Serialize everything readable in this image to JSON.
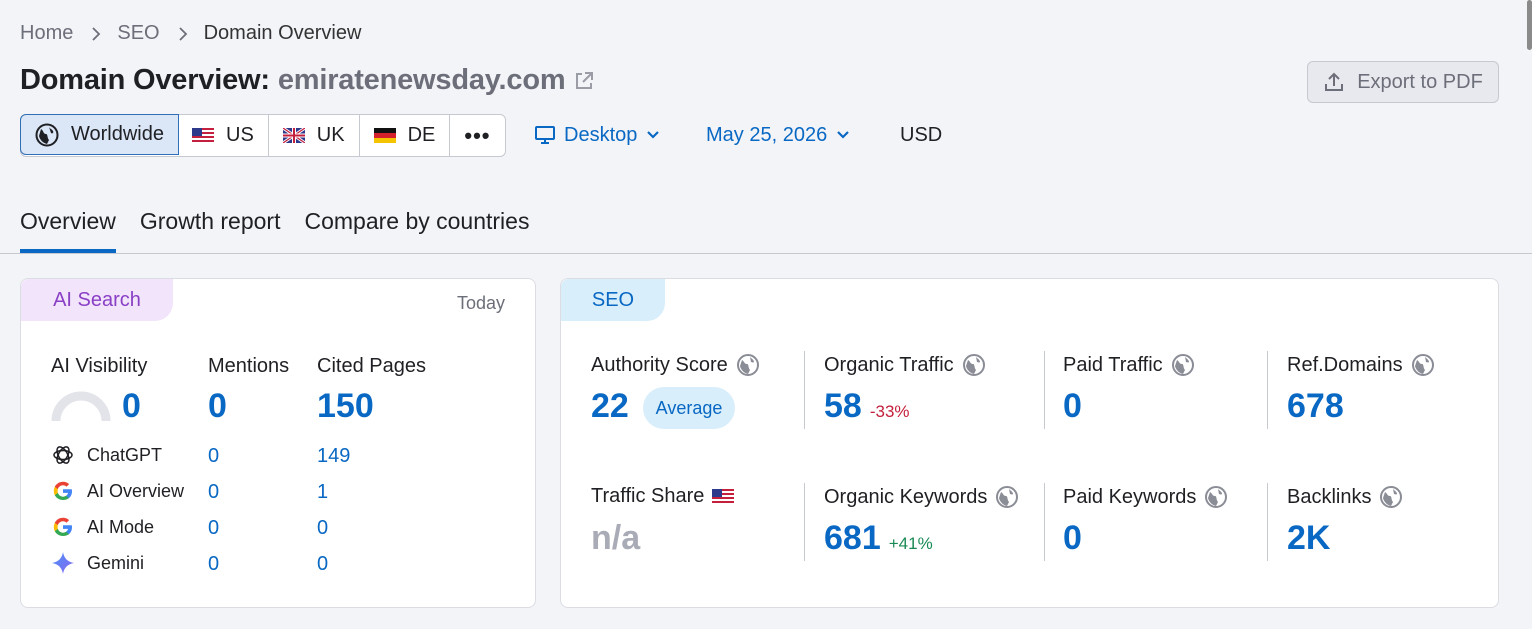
{
  "breadcrumb": {
    "home": "Home",
    "seo": "SEO",
    "current": "Domain Overview"
  },
  "title": {
    "prefix": "Domain Overview:",
    "domain": "emiratenewsday.com"
  },
  "export_label": "Export to PDF",
  "regions": [
    {
      "label": "Worldwide",
      "icon": "globe-icon",
      "active": true
    },
    {
      "label": "US",
      "icon": "flag-us-icon"
    },
    {
      "label": "UK",
      "icon": "flag-uk-icon"
    },
    {
      "label": "DE",
      "icon": "flag-de-icon"
    }
  ],
  "more_label": "•••",
  "device_label": "Desktop",
  "date_label": "May 25, 2026",
  "currency": "USD",
  "tabs": [
    "Overview",
    "Growth report",
    "Compare by countries"
  ],
  "ai": {
    "pill": "AI Search",
    "today": "Today",
    "visibility_label": "AI Visibility",
    "visibility_value": "0",
    "mentions_label": "Mentions",
    "mentions_value": "0",
    "cited_label": "Cited Pages",
    "cited_value": "150",
    "rows": [
      {
        "name": "ChatGPT",
        "mentions": "0",
        "cited": "149"
      },
      {
        "name": "AI Overview",
        "mentions": "0",
        "cited": "1"
      },
      {
        "name": "AI Mode",
        "mentions": "0",
        "cited": "0"
      },
      {
        "name": "Gemini",
        "mentions": "0",
        "cited": "0"
      }
    ]
  },
  "seo": {
    "pill": "SEO",
    "authority_label": "Authority Score",
    "authority_value": "22",
    "authority_badge": "Average",
    "organic_traffic_label": "Organic Traffic",
    "organic_traffic_value": "58",
    "organic_traffic_change": "-33%",
    "paid_traffic_label": "Paid Traffic",
    "paid_traffic_value": "0",
    "ref_domains_label": "Ref.Domains",
    "ref_domains_value": "678",
    "traffic_share_label": "Traffic Share",
    "traffic_share_value": "n/a",
    "organic_keywords_label": "Organic Keywords",
    "organic_keywords_value": "681",
    "organic_keywords_change": "+41%",
    "paid_keywords_label": "Paid Keywords",
    "paid_keywords_value": "0",
    "backlinks_label": "Backlinks",
    "backlinks_value": "2K"
  },
  "colors": {
    "accent": "#0968c3",
    "negative": "#c4203d",
    "positive": "#1a8a55",
    "ai_pill": "#f1e4fb",
    "seo_pill": "#d8eefb"
  }
}
